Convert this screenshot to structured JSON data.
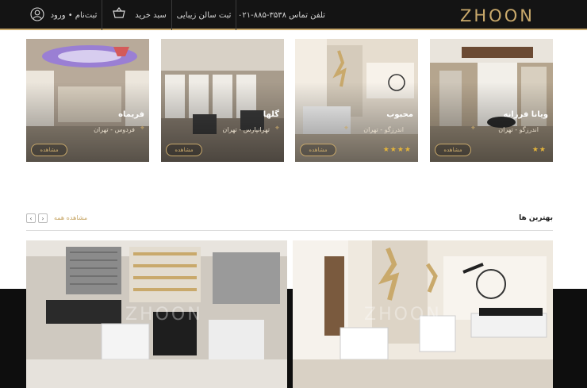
{
  "header": {
    "logo_text": "ZHOON",
    "phone_label": "تلفن تماس ۳۵۳۸-۸۸۵-۰۲۱",
    "register_salon": "ثبت سالن زیبایی",
    "cart": "سبد خرید",
    "login": "ثبت‌نام • ورود",
    "colors": {
      "bar": "#141414",
      "accent": "#c9a96b"
    },
    "icons": {
      "cart": "cart-icon",
      "user": "user-icon"
    }
  },
  "salons": [
    {
      "name": "ویانا فرزانه",
      "location": "اندرزگو - تهران",
      "stars": "★★",
      "button": "مشاهده"
    },
    {
      "name": "محبوب",
      "location": "اندرزگو - تهران",
      "stars": "★★★★",
      "button": "مشاهده"
    },
    {
      "name": "گلها",
      "location": "تهرانپارس - تهران",
      "stars": "",
      "button": "مشاهده"
    },
    {
      "name": "فریماه",
      "location": "فردوس - تهران",
      "stars": "",
      "button": "مشاهده"
    }
  ],
  "best": {
    "title": "بهترین ها",
    "see_all": "مشاهده همه",
    "prev": "‹",
    "next": "›"
  }
}
